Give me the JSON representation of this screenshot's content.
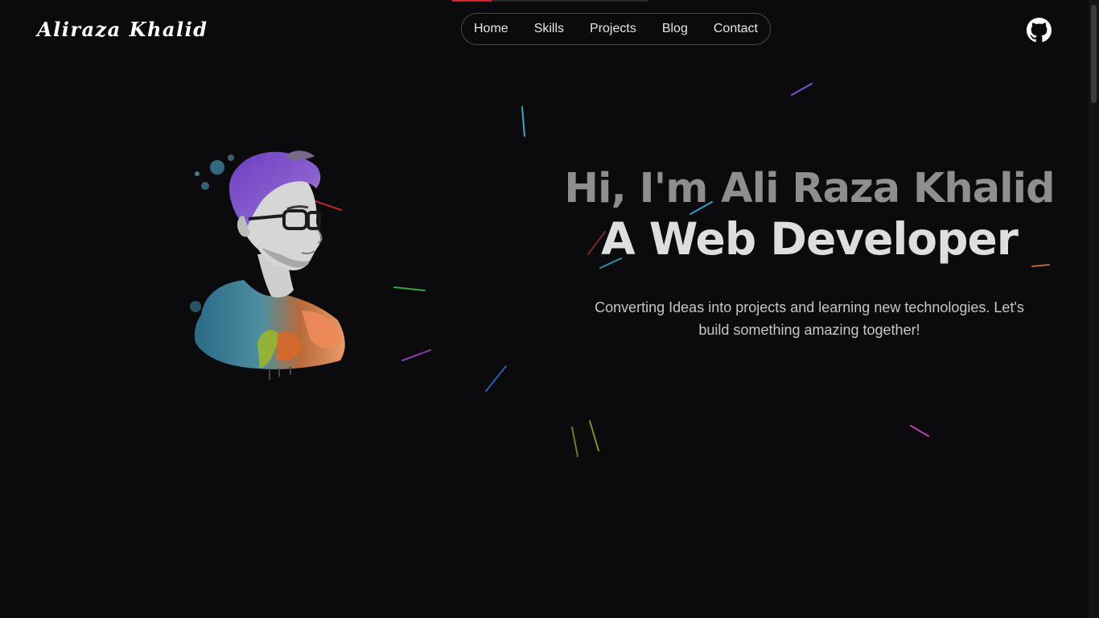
{
  "header": {
    "logo_text": "Aliraza Khalid",
    "nav": [
      {
        "label": "Home"
      },
      {
        "label": "Skills"
      },
      {
        "label": "Projects"
      },
      {
        "label": "Blog"
      },
      {
        "label": "Contact"
      }
    ],
    "github_icon": "github-icon"
  },
  "scroll_progress": 0.2,
  "hero": {
    "line1": "Hi, I'm Ali Raza Khalid",
    "line2": "A Web Developer",
    "description": "Converting Ideas into projects and learning new technologies. Let's build something amazing together!"
  },
  "colors": {
    "background": "#0b0b0d",
    "accent_progress": "#d8232a",
    "nav_border": "#4b4b50",
    "heading_dim": "#8e8e8e",
    "heading_bright": "#dedede"
  }
}
